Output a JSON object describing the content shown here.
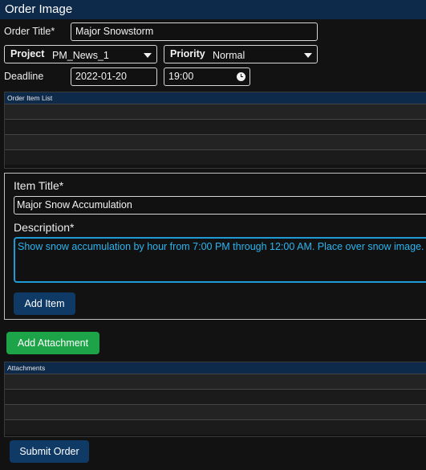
{
  "header": {
    "title": "Order Image"
  },
  "form": {
    "order_title_label": "Order Title*",
    "order_title_value": "Major Snowstorm",
    "project_label": "Project",
    "project_value": "PM_News_1",
    "priority_label": "Priority",
    "priority_value": "Normal",
    "deadline_label": "Deadline",
    "deadline_date": "2022-01-20",
    "deadline_time": "19:00"
  },
  "order_items": {
    "header": "Order Item List"
  },
  "item_panel": {
    "item_title_label": "Item Title*",
    "item_title_value": "Major Snow Accumulation",
    "description_label": "Description*",
    "description_value": "Show snow accumulation by hour from 7:00 PM through 12:00 AM. Place over snow image.",
    "add_item_label": "Add Item"
  },
  "add_attachment_label": "Add Attachment",
  "attachments": {
    "header": "Attachments"
  },
  "submit_label": "Submit Order",
  "icons": {
    "caret": "chevron-down-icon",
    "clock": "clock-icon"
  },
  "colors": {
    "header_bg": "#0d2a4a",
    "accent_blue": "#1e9ad6",
    "green_button": "#1da348",
    "navy_button": "#0f3a66"
  }
}
